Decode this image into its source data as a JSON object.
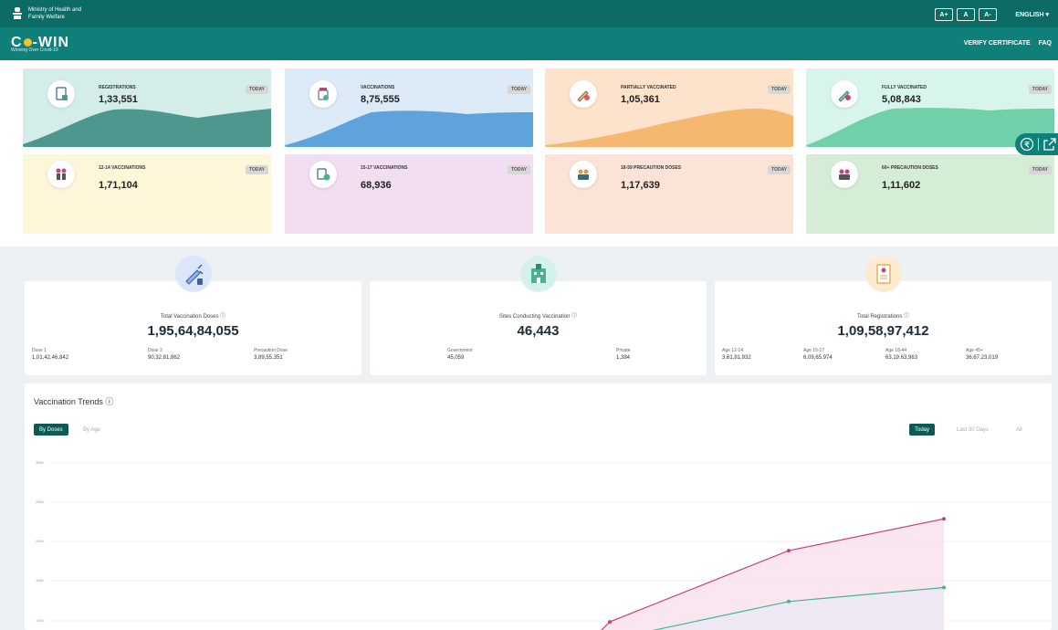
{
  "header": {
    "ministry": "Ministry of Health and Family Welfare",
    "font_controls": [
      "A+",
      "A",
      "A-"
    ],
    "language": "ENGLISH"
  },
  "nav": {
    "logo_text_before": "C",
    "logo_text_after": "-WIN",
    "tagline": "Winning Over Covid-19",
    "links": [
      "VERIFY CERTIFICATE",
      "FAQ"
    ]
  },
  "tiles": [
    {
      "label": "REGISTRATIONS",
      "value": "1,33,551",
      "badge": "TODAY",
      "icon": "registration-icon",
      "color": "#d5ede9",
      "fill": "#4e978e"
    },
    {
      "label": "VACCINATIONS",
      "value": "8,75,555",
      "badge": "TODAY",
      "icon": "vaccine-vial-icon",
      "color": "#dcebf7",
      "fill": "#5fa3dd"
    },
    {
      "label": "PARTIALLY VACCINATED",
      "value": "1,05,361",
      "badge": "TODAY",
      "icon": "partial-vaccine-icon",
      "color": "#fde3cc",
      "fill": "#f6b870"
    },
    {
      "label": "FULLY VACCINATED",
      "value": "5,08,843",
      "badge": "TODAY",
      "icon": "full-vaccine-icon",
      "color": "#d8f5ec",
      "fill": "#6fd0a9"
    },
    {
      "label": "12-14 VACCINATIONS",
      "value": "1,71,104",
      "badge": "TODAY",
      "icon": "children-icon",
      "color": "#fdf6d9"
    },
    {
      "label": "15-17 VACCINATIONS",
      "value": "68,936",
      "badge": "TODAY",
      "icon": "teen-icon",
      "color": "#f1def0"
    },
    {
      "label": "18-59 PRECAUTION DOSES",
      "value": "1,17,639",
      "badge": "TODAY",
      "icon": "adults-icon",
      "color": "#fbe4d6"
    },
    {
      "label": "60+ PRECAUTION DOSES",
      "value": "1,11,602",
      "badge": "TODAY",
      "icon": "seniors-icon",
      "color": "#d6edd5"
    }
  ],
  "cards": [
    {
      "title": "Total Vaccination Doses ⓘ",
      "value": "1,95,64,84,055",
      "icon": "syringe-icon",
      "icon_bg": "#dbe6fb",
      "subs": [
        {
          "label": "Dose 1",
          "value": "1,01,42,46,842"
        },
        {
          "label": "Dose 2",
          "value": "90,32,81,862"
        },
        {
          "label": "Precaution Dose",
          "value": "3,89,55,351"
        }
      ]
    },
    {
      "title": "Sites Conducting Vaccination ⓘ",
      "value": "46,443",
      "icon": "hospital-icon",
      "icon_bg": "#d4f2ea",
      "subs": [
        {
          "label": "Government",
          "value": "45,059"
        },
        {
          "label": "Private",
          "value": "1,384"
        }
      ]
    },
    {
      "title": "Total Registrations ⓘ",
      "value": "1,09,58,97,412",
      "icon": "registration-form-icon",
      "icon_bg": "#fdebcf",
      "subs": [
        {
          "label": "Age 12-14",
          "value": "3,61,81,932"
        },
        {
          "label": "Age 15-17",
          "value": "6,09,65,974"
        },
        {
          "label": "Age 18-44",
          "value": "63,19,63,963"
        },
        {
          "label": "Age 45+",
          "value": "36,67,23,019"
        }
      ]
    }
  ],
  "trends": {
    "title": "Vaccination Trends ⓘ",
    "tabs_left": [
      "By Doses",
      "By Age"
    ],
    "tabs_right": [
      "Today",
      "Last 30 Days",
      "All"
    ]
  },
  "chart_data": {
    "type": "area",
    "title": "",
    "xlabel": "",
    "ylabel": "",
    "y_ticks": [
      "350k",
      "250k",
      "200k",
      "150k",
      "100k"
    ],
    "ylim": [
      80000,
      350000
    ],
    "x": [
      0,
      1,
      2,
      3,
      4,
      5
    ],
    "series": [
      {
        "color": "#c2457e",
        "fill": "#f8e2ee",
        "values": [
          null,
          null,
          null,
          100000,
          212000,
          262000
        ]
      },
      {
        "color": "#46b48e",
        "fill": "#ece7f6",
        "values": [
          null,
          null,
          null,
          72000,
          132000,
          154000
        ]
      }
    ],
    "grid": true
  }
}
